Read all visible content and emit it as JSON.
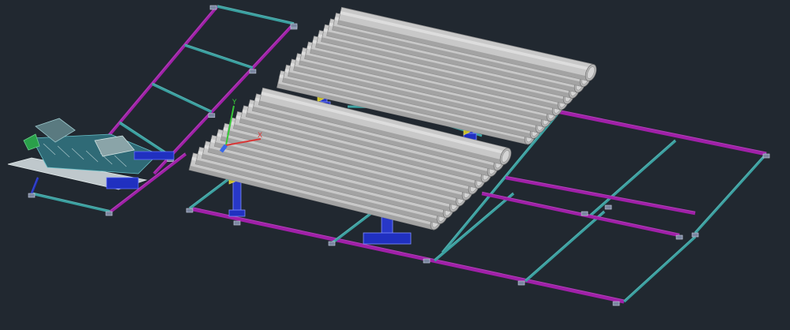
{
  "viewport": {
    "background": "#212830"
  },
  "palette": {
    "frame_magenta": "#a020a8",
    "frame_teal": "#3aa0a0",
    "frame_blue": "#2030c0",
    "pipe_fill": "#c8c8c8",
    "pipe_shade": "#9a9a9a",
    "pipe_highlight": "#e6e6e6",
    "pipe_end": "#b4b4b4",
    "support_blue": "#2838c8",
    "support_yellow": "#c8c028",
    "ucs_x": "#d83838",
    "ucs_y": "#38c838",
    "ucs_z": "#3868e8"
  },
  "ucs_icon": {
    "x_label": "X",
    "y_label": "Y"
  },
  "pipe_rack_back": {
    "pipe_count": 12
  },
  "pipe_rack_front": {
    "pipe_count": 12
  }
}
